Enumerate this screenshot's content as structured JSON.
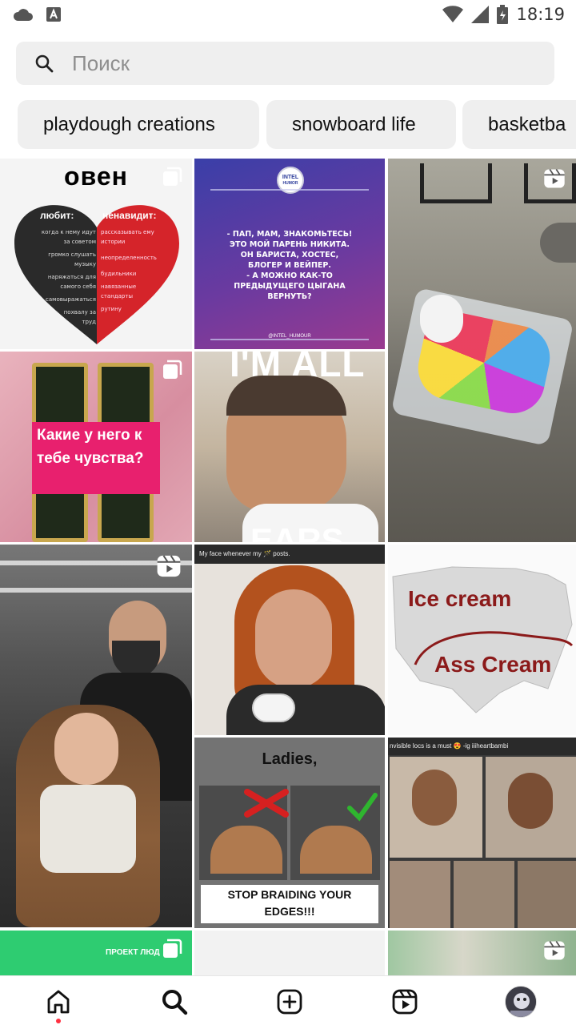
{
  "status_bar": {
    "time": "18:19",
    "icons": [
      "cloud-icon",
      "keyboard-a-icon",
      "wifi-icon",
      "cell-signal-icon",
      "battery-icon"
    ]
  },
  "search": {
    "placeholder": "Поиск"
  },
  "chips": [
    {
      "label": "playdough creations"
    },
    {
      "label": "snowboard life"
    },
    {
      "label": "basketba"
    }
  ],
  "grid": {
    "tile_1": {
      "title": "овен",
      "left_heading": "любит:",
      "right_heading": "ненавидит:",
      "left_lines": [
        "когда к нему идут",
        "за советом",
        "громко слушать",
        "музыку",
        "наряжаться для",
        "самого себя",
        "самовыражаться",
        "похвалу за",
        "труд"
      ],
      "right_lines": [
        "рассказывать ему",
        "истории",
        "неопределенность",
        "будильники",
        "навязанные",
        "стандарты",
        "рутину"
      ],
      "badge": "carousel-icon"
    },
    "tile_2": {
      "logo_top": "INTEL",
      "logo_bottom": "HUMOR",
      "text_lines": [
        "- ПАП, МАМ, ЗНАКОМЬТЕСЬ!",
        "ЭТО МОЙ ПАРЕНЬ НИКИТА.",
        "ОН БАРИСТА, ХОСТЕС,",
        "БЛОГЕР И ВЕЙПЕР.",
        "- А МОЖНО КАК-ТО",
        "ПРЕДЫДУЩЕГО ЦЫГАНА",
        "ВЕРНУТЬ?"
      ],
      "footer": "@INTEL_HUMOUR"
    },
    "tile_3": {
      "badge": "reels-icon"
    },
    "tile_4": {
      "caption_line1": "Какие у него к",
      "caption_line2": "тебе чувства?",
      "badge": "carousel-icon"
    },
    "tile_5": {
      "top_text": "I'M ALL",
      "bottom_text": "EARS"
    },
    "tile_6": {},
    "tile_7": {
      "badge": "reels-icon"
    },
    "tile_8": {
      "caption": "My face whenever my 🪄 posts."
    },
    "tile_9": {
      "line1": "Ice cream",
      "line2": "Ass Cream"
    },
    "tile_10": {
      "heading": "Ladies,",
      "footer_line1": "STOP BRAIDING YOUR",
      "footer_line2": "EDGES!!!"
    },
    "tile_11": {
      "caption": "nvisible locs is a must 😍 -ig iiiheartbambi"
    },
    "tile_12": {
      "label": "ПРОЕКТ ЛЮД",
      "badge": "carousel-icon"
    },
    "tile_13": {},
    "tile_14": {
      "badge": "reels-icon"
    }
  },
  "bottom_nav": {
    "items": [
      "home-icon",
      "search-icon",
      "create-icon",
      "reels-icon",
      "profile-avatar"
    ]
  },
  "colors": {
    "chip_bg": "#efefef",
    "search_bg": "#efefef",
    "notification_dot": "#ff3040",
    "ice_cream_red": "#8b1a1a",
    "pink_caption": "#e8206e"
  }
}
